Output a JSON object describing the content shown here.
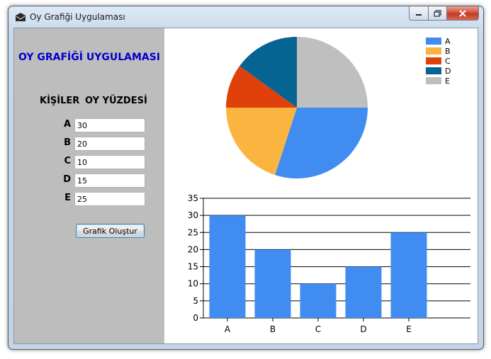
{
  "window": {
    "title": "Oy Grafiği Uygulaması"
  },
  "form": {
    "app_title": "OY GRAFİĞİ UYGULAMASI",
    "header_people": "KİŞİLER",
    "header_percent": "OY YÜZDESİ",
    "rows": [
      {
        "label": "A",
        "value": "30"
      },
      {
        "label": "B",
        "value": "20"
      },
      {
        "label": "C",
        "value": "10"
      },
      {
        "label": "D",
        "value": "15"
      },
      {
        "label": "E",
        "value": "25"
      }
    ],
    "button_label": "Grafik Oluştur"
  },
  "colors": {
    "A": "#418cf0",
    "B": "#fcb441",
    "C": "#e0400a",
    "D": "#056492",
    "E": "#bfbfbf",
    "panel": "#bdbdbd",
    "title_text": "#0000cd"
  },
  "chart_data": [
    {
      "type": "pie",
      "categories": [
        "A",
        "B",
        "C",
        "D",
        "E"
      ],
      "values": [
        30,
        20,
        10,
        15,
        25
      ],
      "colors": [
        "#418cf0",
        "#fcb441",
        "#e0400a",
        "#056492",
        "#bfbfbf"
      ],
      "legend": "top-right"
    },
    {
      "type": "bar",
      "categories": [
        "A",
        "B",
        "C",
        "D",
        "E"
      ],
      "values": [
        30,
        20,
        10,
        15,
        25
      ],
      "ylim": [
        0,
        35
      ],
      "yticks": [
        0,
        5,
        10,
        15,
        20,
        25,
        30,
        35
      ],
      "grid": true,
      "color": "#418cf0"
    }
  ]
}
